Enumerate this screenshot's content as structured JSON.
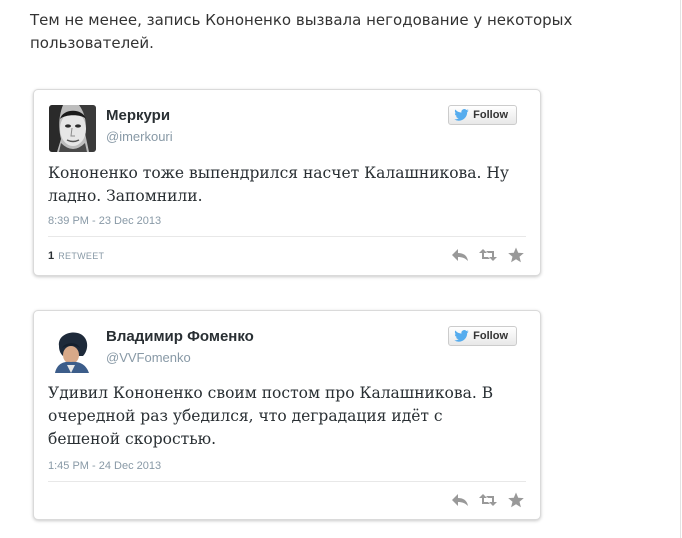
{
  "intro_text": "Тем не менее, запись Кононенко вызвала негодование у некоторых пользователей.",
  "colors": {
    "follow_bird": "#55acee",
    "action_icons": "#999999",
    "handle": "#8899a6"
  },
  "tweets": [
    {
      "name": "Меркури",
      "handle": "@imerkouri",
      "follow_label": "Follow",
      "text": "Кононенко тоже выпендрился насчет Калашникова. Ну ладно. Запомнили.",
      "timestamp": "8:39 PM - 23 Dec 2013",
      "retweet_count": "1",
      "retweet_label": "RETWEET",
      "icons": [
        "twitter-bird-icon",
        "reply-icon",
        "retweet-icon",
        "favorite-icon"
      ]
    },
    {
      "name": "Владимир Фоменко",
      "handle": "@VVFomenko",
      "follow_label": "Follow",
      "text": "Удивил Кононенко своим постом про Калашникова. В очередной раз убедился, что деградация идёт с бешеной скоростью.",
      "timestamp": "1:45 PM - 24 Dec 2013",
      "icons": [
        "twitter-bird-icon",
        "reply-icon",
        "retweet-icon",
        "favorite-icon"
      ]
    }
  ]
}
